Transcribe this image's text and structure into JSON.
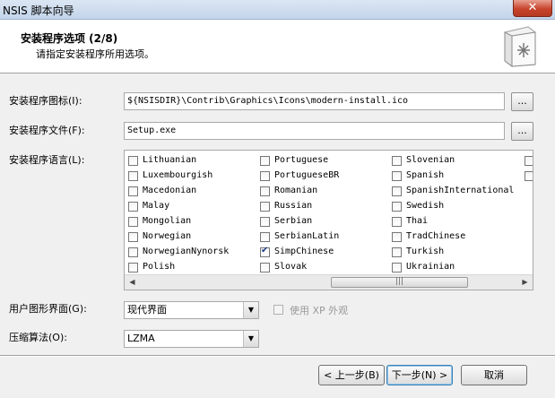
{
  "window": {
    "title": "NSIS 脚本向导",
    "close_label": "✕"
  },
  "header": {
    "title": "安装程序选项 (2/8)",
    "subtitle": "请指定安装程序所用选项。"
  },
  "installer_icon": {
    "label": "安装程序图标(I):",
    "value": "${NSISDIR}\\Contrib\\Graphics\\Icons\\modern-install.ico",
    "browse_label": "..."
  },
  "installer_file": {
    "label": "安装程序文件(F):",
    "value": "Setup.exe",
    "browse_label": "..."
  },
  "languages": {
    "label": "安装程序语言(L):",
    "columns": [
      [
        {
          "name": "Lithuanian",
          "checked": false
        },
        {
          "name": "Luxembourgish",
          "checked": false
        },
        {
          "name": "Macedonian",
          "checked": false
        },
        {
          "name": "Malay",
          "checked": false
        },
        {
          "name": "Mongolian",
          "checked": false
        },
        {
          "name": "Norwegian",
          "checked": false
        },
        {
          "name": "NorwegianNynorsk",
          "checked": false
        },
        {
          "name": "Polish",
          "checked": false
        }
      ],
      [
        {
          "name": "Portuguese",
          "checked": false
        },
        {
          "name": "PortugueseBR",
          "checked": false
        },
        {
          "name": "Romanian",
          "checked": false
        },
        {
          "name": "Russian",
          "checked": false
        },
        {
          "name": "Serbian",
          "checked": false
        },
        {
          "name": "SerbianLatin",
          "checked": false
        },
        {
          "name": "SimpChinese",
          "checked": true
        },
        {
          "name": "Slovak",
          "checked": false
        }
      ],
      [
        {
          "name": "Slovenian",
          "checked": false
        },
        {
          "name": "Spanish",
          "checked": false
        },
        {
          "name": "SpanishInternational",
          "checked": false
        },
        {
          "name": "Swedish",
          "checked": false
        },
        {
          "name": "Thai",
          "checked": false
        },
        {
          "name": "TradChinese",
          "checked": false
        },
        {
          "name": "Turkish",
          "checked": false
        },
        {
          "name": "Ukrainian",
          "checked": false
        }
      ]
    ],
    "scrollbar": {
      "left_arrow": "◀",
      "right_arrow": "▶",
      "grip": "|||"
    }
  },
  "ui": {
    "label": "用户图形界面(G):",
    "value": "现代界面",
    "custom_checkbox_label": "使用 XP 外观",
    "arrow": "▼"
  },
  "compression": {
    "label": "压缩算法(O):",
    "value": "LZMA",
    "arrow": "▼"
  },
  "buttons": {
    "back": "< 上一步(B)",
    "next": "下一步(N) >",
    "cancel": "取消"
  }
}
